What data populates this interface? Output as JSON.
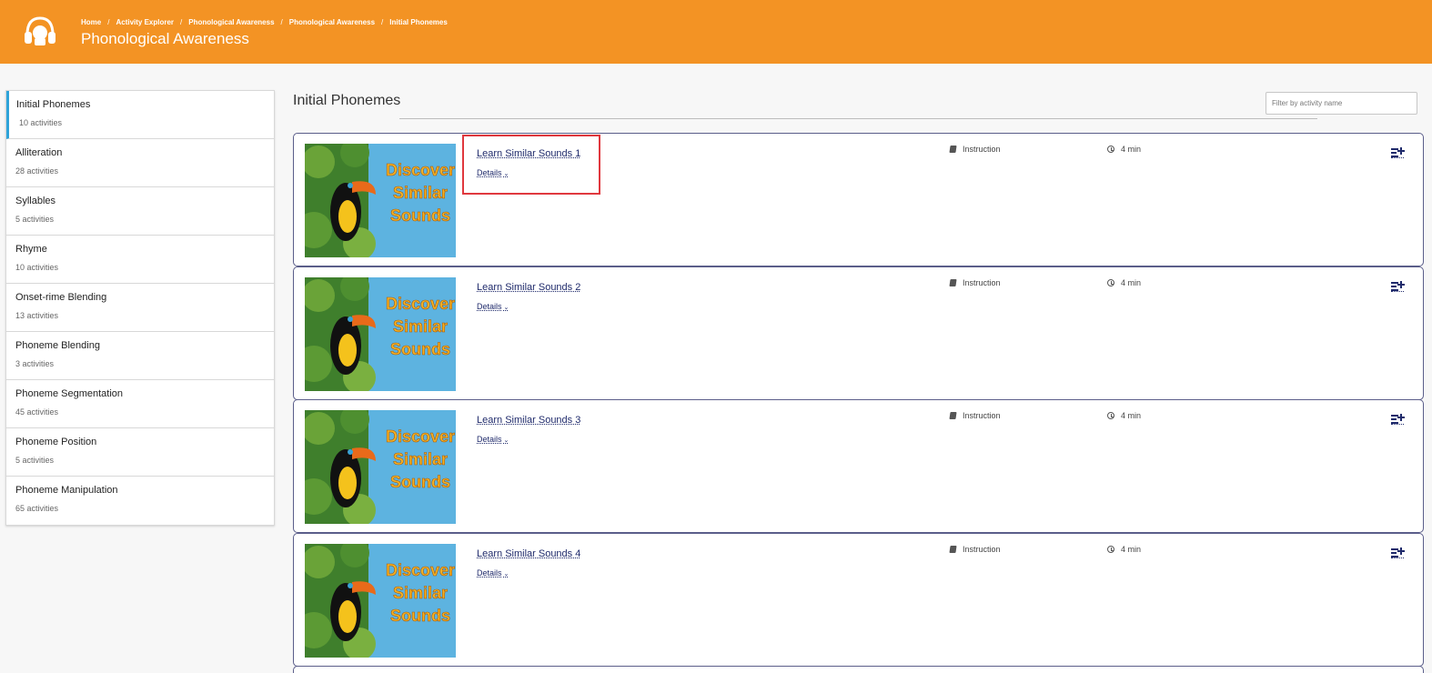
{
  "header": {
    "title": "Phonological Awareness",
    "breadcrumb": [
      "Home",
      "Activity Explorer",
      "Phonological Awareness",
      "Phonological Awareness",
      "Initial Phonemes"
    ],
    "breadcrumb_separator": "/"
  },
  "sidebar": {
    "items": [
      {
        "label": "Initial Phonemes",
        "count": "10 activities",
        "active": true
      },
      {
        "label": "Alliteration",
        "count": "28 activities"
      },
      {
        "label": "Syllables",
        "count": "5 activities"
      },
      {
        "label": "Rhyme",
        "count": "10 activities"
      },
      {
        "label": "Onset-rime Blending",
        "count": "13 activities"
      },
      {
        "label": "Phoneme Blending",
        "count": "3 activities"
      },
      {
        "label": "Phoneme Segmentation",
        "count": "45 activities"
      },
      {
        "label": "Phoneme Position",
        "count": "5 activities"
      },
      {
        "label": "Phoneme Manipulation",
        "count": "65 activities"
      }
    ]
  },
  "main": {
    "title": "Initial Phonemes",
    "filter_placeholder": "Filter by activity name",
    "thumbnail_text": [
      "Discover",
      "Similar",
      "Sounds"
    ],
    "activities": [
      {
        "title": "Learn Similar Sounds 1",
        "details": "Details",
        "type": "Instruction",
        "duration": "4 min",
        "highlighted": true
      },
      {
        "title": "Learn Similar Sounds 2",
        "details": "Details",
        "type": "Instruction",
        "duration": "4 min"
      },
      {
        "title": "Learn Similar Sounds 3",
        "details": "Details",
        "type": "Instruction",
        "duration": "4 min"
      },
      {
        "title": "Learn Similar Sounds 4",
        "details": "Details",
        "type": "Instruction",
        "duration": "4 min"
      }
    ]
  },
  "colors": {
    "header": "#f39324",
    "active_accent": "#2ea3d9",
    "link": "#1f2a6b",
    "highlight": "#e0383e"
  },
  "icons": {
    "logo": "headphones-icon",
    "type": "book-icon",
    "duration": "clock-icon",
    "add": "add-to-playlist-icon",
    "details": "chevron-down-icon"
  }
}
